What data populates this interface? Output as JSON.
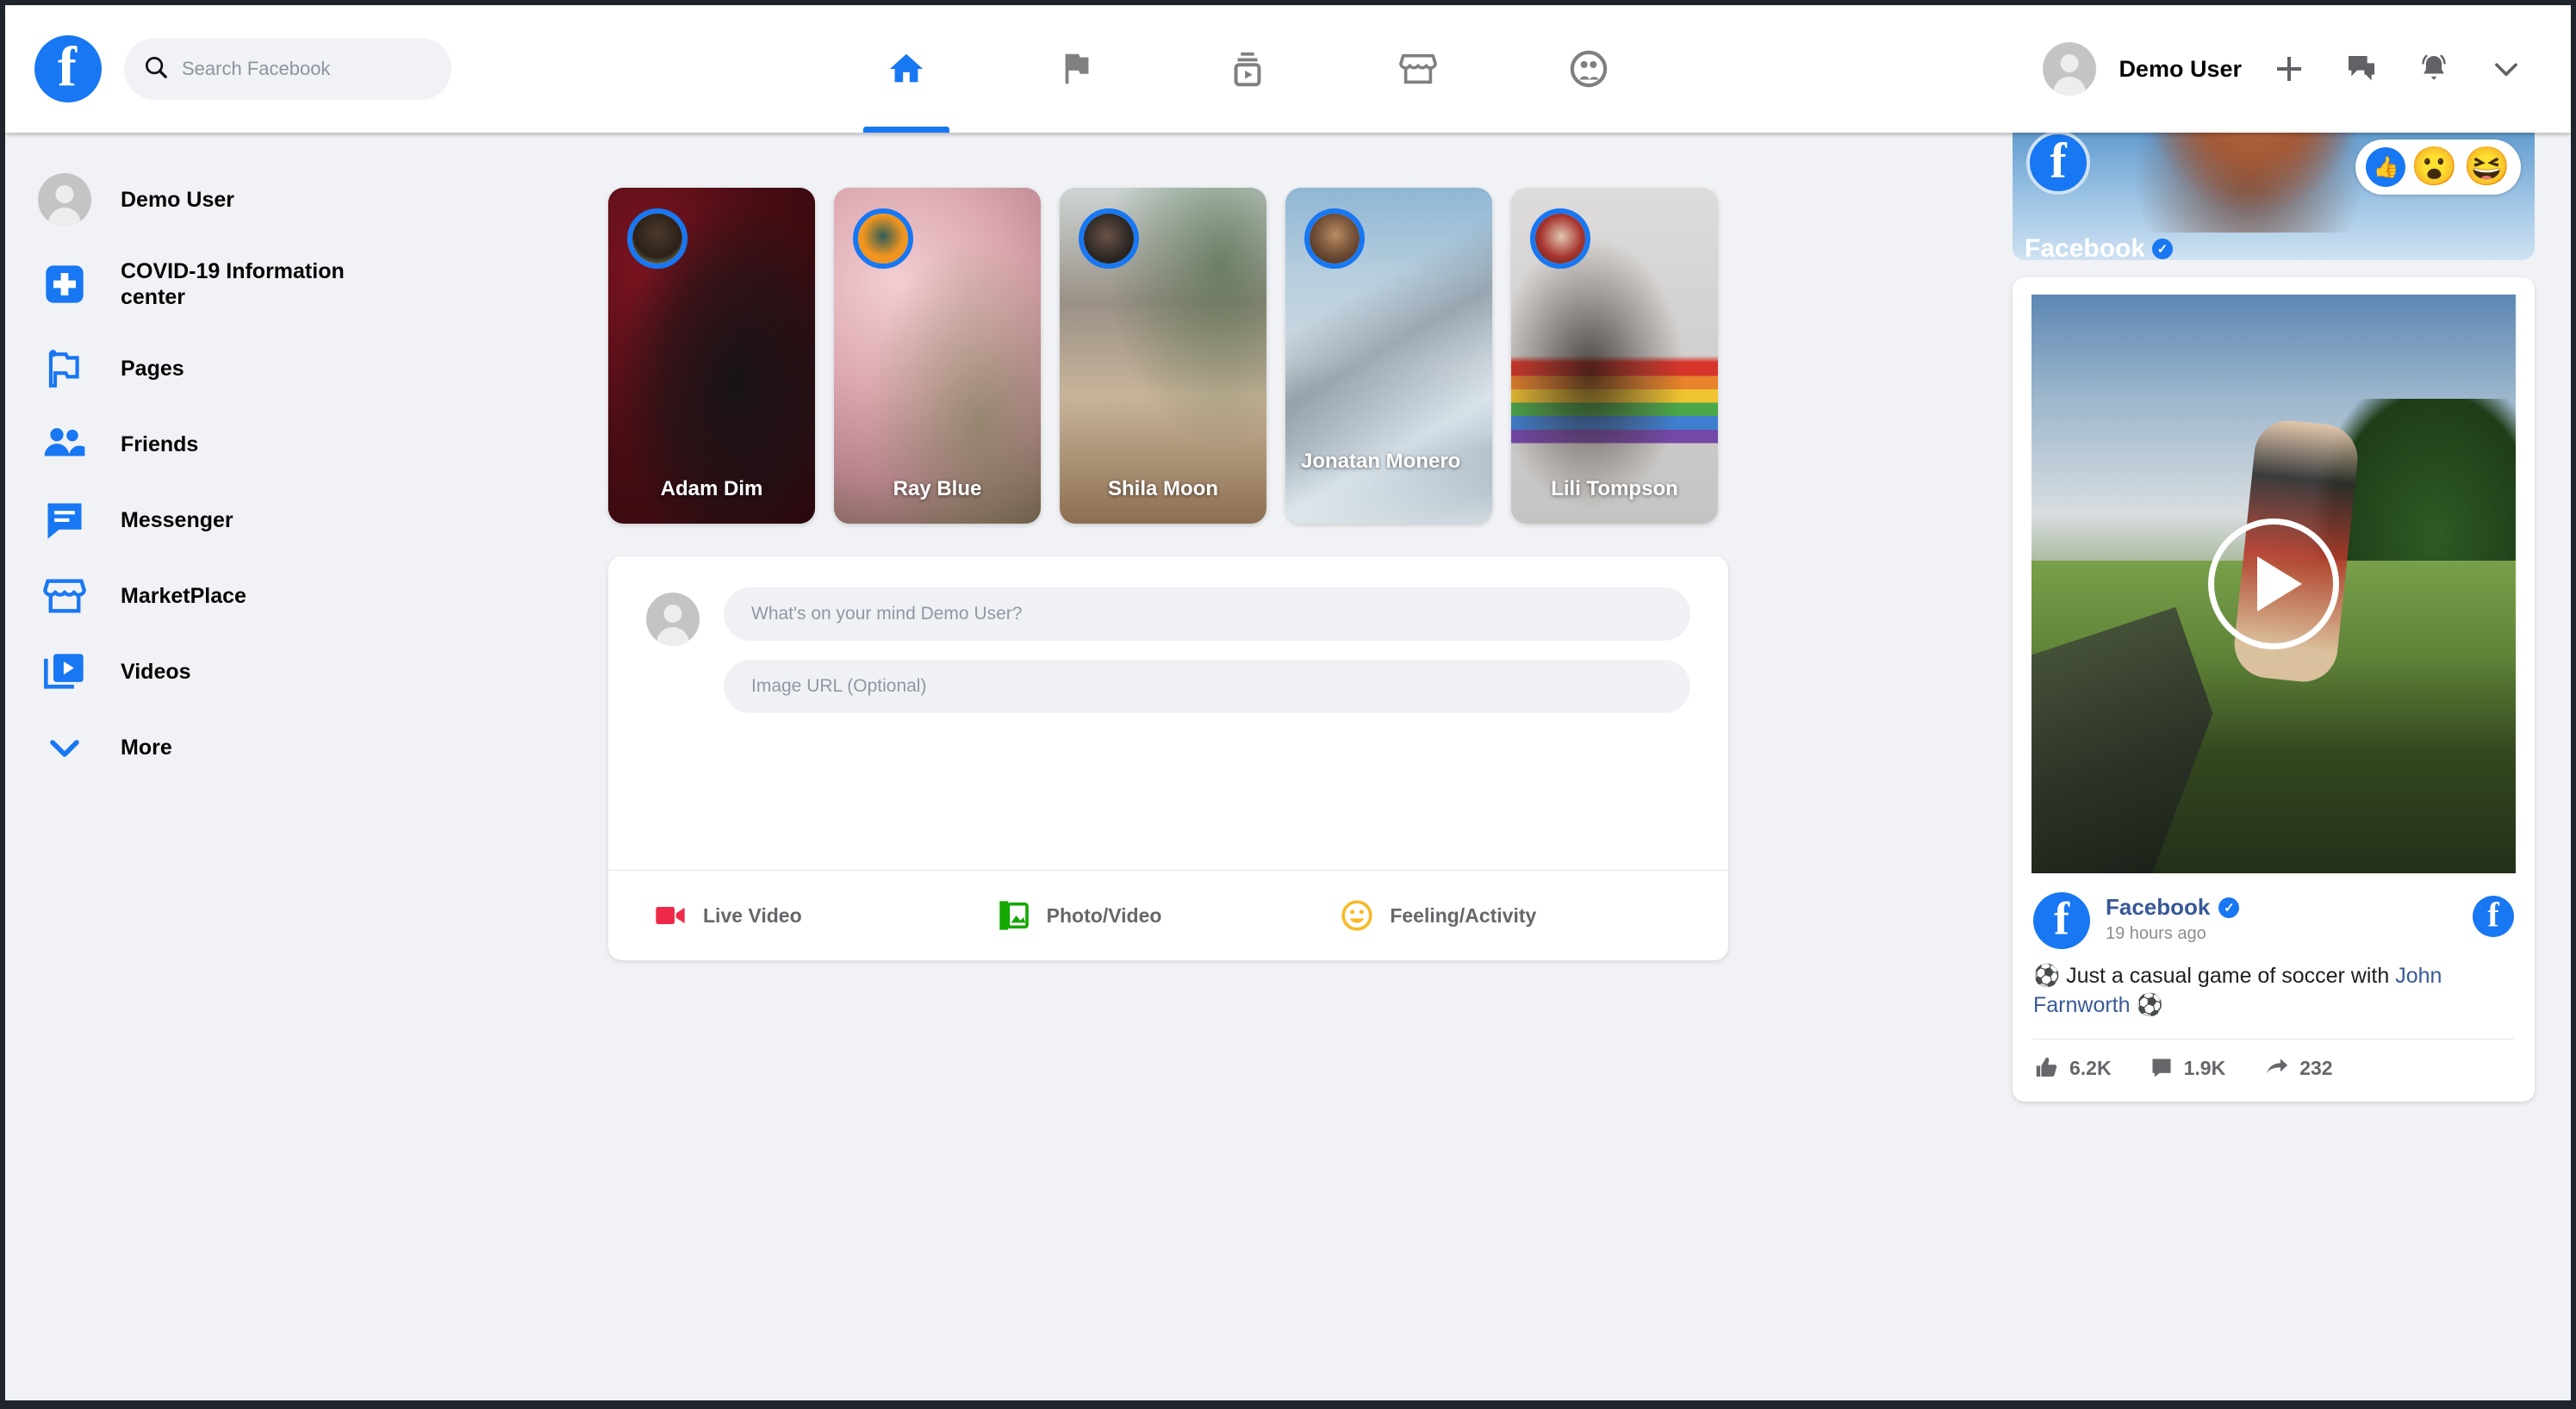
{
  "header": {
    "logo_icon": "facebook-logo",
    "search": {
      "placeholder": "Search Facebook",
      "value": "",
      "icon": "search-icon"
    },
    "nav": [
      {
        "name": "home",
        "icon": "home-icon",
        "active": true
      },
      {
        "name": "pages",
        "icon": "flag-icon",
        "active": false
      },
      {
        "name": "watch",
        "icon": "watch-video-icon",
        "active": false
      },
      {
        "name": "marketplace",
        "icon": "marketplace-icon",
        "active": false
      },
      {
        "name": "groups",
        "icon": "groups-icon",
        "active": false
      }
    ],
    "username": "Demo User",
    "actions": [
      {
        "name": "create",
        "icon": "plus-icon"
      },
      {
        "name": "messenger",
        "icon": "messenger-icon"
      },
      {
        "name": "notifications",
        "icon": "bell-icon"
      },
      {
        "name": "account-menu",
        "icon": "chevron-down-icon"
      }
    ]
  },
  "sidebar": {
    "items": [
      {
        "label": "Demo User",
        "icon": "avatar-icon"
      },
      {
        "label": "COVID-19 Information center",
        "icon": "covid-cross-icon"
      },
      {
        "label": "Pages",
        "icon": "flag-icon"
      },
      {
        "label": "Friends",
        "icon": "friends-icon"
      },
      {
        "label": "Messenger",
        "icon": "messenger-icon"
      },
      {
        "label": "MarketPlace",
        "icon": "marketplace-icon"
      },
      {
        "label": "Videos",
        "icon": "videos-icon"
      },
      {
        "label": "More",
        "icon": "chevron-down-icon"
      }
    ]
  },
  "stories": [
    {
      "name": "Adam Dim",
      "bg": "#4a1016",
      "avatar_bg": "#8a9a7c"
    },
    {
      "name": "Ray Blue",
      "bg": "#d9a9b0",
      "avatar_bg": "#f0951f"
    },
    {
      "name": "Shila Moon",
      "bg": "#b9aa99",
      "avatar_bg": "#6d6c6a"
    },
    {
      "name": "Jonatan Monero",
      "bg": "#9ab6cf",
      "avatar_bg": "#7a5a47"
    },
    {
      "name": "Lili Tompson",
      "bg": "#d6d4d2",
      "avatar_bg": "#9c3d3d"
    }
  ],
  "composer": {
    "status_placeholder": "What's on your mind Demo User?",
    "status_value": "",
    "image_url_placeholder": "Image URL (Optional)",
    "image_url_value": "",
    "actions": [
      {
        "label": "Live Video",
        "icon": "live-video-icon",
        "color": "#F02849"
      },
      {
        "label": "Photo/Video",
        "icon": "photo-video-icon",
        "color": "#14A800"
      },
      {
        "label": "Feeling/Activity",
        "icon": "feeling-activity-icon",
        "color": "#F7B928"
      }
    ]
  },
  "right_column": {
    "top_post": {
      "page_name": "Facebook",
      "verified": true,
      "reactions": [
        "like",
        "wow",
        "haha"
      ]
    },
    "video_post": {
      "page_name": "Facebook",
      "verified": true,
      "timestamp": "19 hours ago",
      "body_prefix": "⚽ Just a casual game of soccer with ",
      "body_link": "John Farnworth",
      "body_suffix": " ⚽",
      "play_icon": "play-button-icon",
      "stats": [
        {
          "icon": "thumbs-up-icon",
          "value": "6.2K"
        },
        {
          "icon": "comment-icon",
          "value": "1.9K"
        },
        {
          "icon": "share-icon",
          "value": "232"
        }
      ]
    }
  },
  "colors": {
    "brand_blue": "#1877F2",
    "page_bg": "#F0F2F5",
    "card_bg": "#FFFFFF",
    "text_primary": "#050505",
    "text_secondary": "#65676B",
    "link": "#385898"
  }
}
